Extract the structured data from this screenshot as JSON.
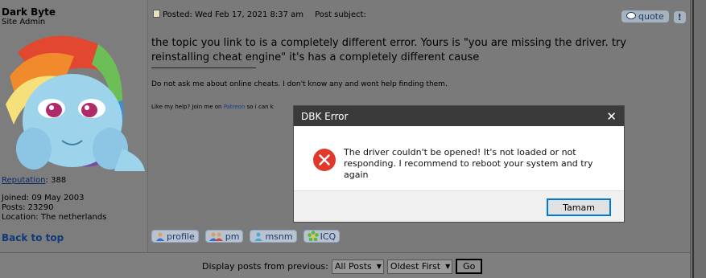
{
  "author": {
    "name": "Dark Byte",
    "rank": "Site Admin",
    "reputation_label": "Reputation",
    "reputation_value": ": 388",
    "joined": "Joined: 09 May 2003",
    "posts": "Posts: 23290",
    "location": "Location: The netherlands"
  },
  "post": {
    "posted": "Posted: Wed Feb 17, 2021 8:37 am",
    "subject": "Post subject:",
    "quote_label": "quote",
    "report_label": "!",
    "body": "the topic you link to is a completely different error. Yours is \"you are missing the driver. try reinstalling cheat engine\" it's has a completely different cause",
    "signature": "Do not ask me about online cheats. I don't know any and wont help finding them.",
    "signature2_prefix": "Like my help? Join me on",
    "signature2_link": "Patreon",
    "signature2_suffix": "so i can k"
  },
  "nav": {
    "back_to_top": "Back to top"
  },
  "profile_buttons": [
    {
      "label": "profile"
    },
    {
      "label": "pm"
    },
    {
      "label": "msnm"
    },
    {
      "label": "ICQ"
    }
  ],
  "footer": {
    "display_label": "Display posts from previous:",
    "posts_select": "All Posts",
    "order_select": "Oldest First",
    "go": "Go"
  },
  "dialog": {
    "title": "DBK Error",
    "close": "✕",
    "message": "The driver couldn't be opened! It's not loaded or not responding. I recommend to reboot your system and try again",
    "ok": "Tamam",
    "icon": "error-icon"
  }
}
